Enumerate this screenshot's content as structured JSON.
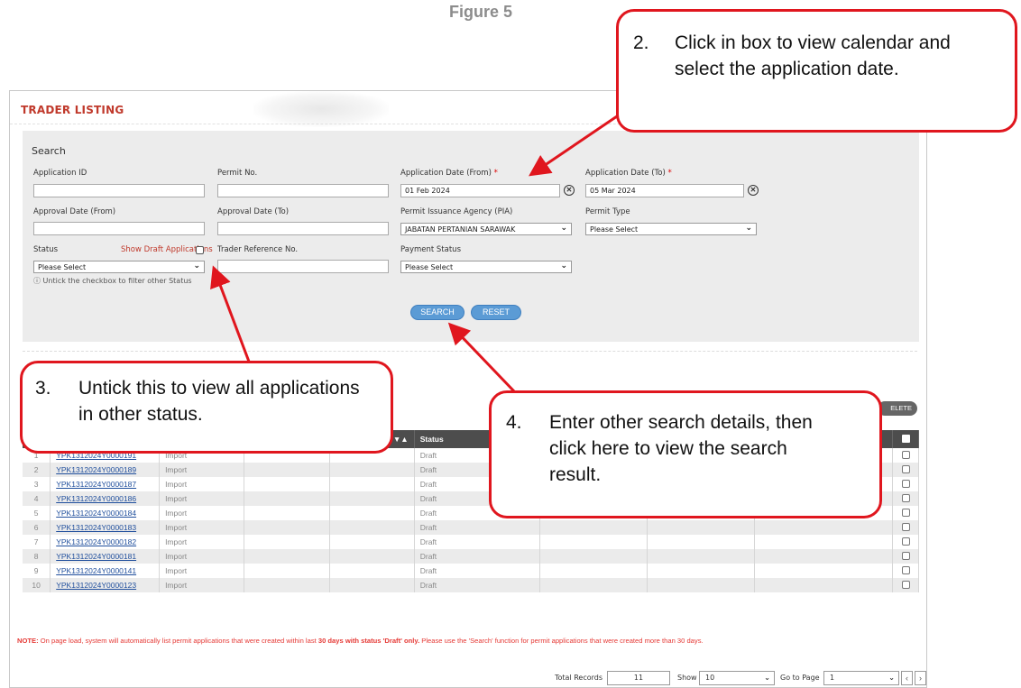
{
  "figure_title": "Figure 5",
  "page_title": "TRADER LISTING",
  "search": {
    "heading": "Search",
    "application_id_label": "Application ID",
    "application_id_value": "",
    "permit_no_label": "Permit No.",
    "permit_no_value": "",
    "app_date_from_label": "Application Date (From)",
    "app_date_from_value": "01 Feb 2024",
    "app_date_to_label": "Application Date (To)",
    "app_date_to_value": "05 Mar 2024",
    "required_mark": "*",
    "approval_date_from_label": "Approval Date (From)",
    "approval_date_to_label": "Approval Date (To)",
    "pia_label": "Permit Issuance Agency (PIA)",
    "pia_value": "JABATAN PERTANIAN SARAWAK",
    "permit_type_label": "Permit Type",
    "permit_type_value": "Please Select",
    "status_label": "Status",
    "show_draft_label": "Show Draft Applications",
    "status_value": "Please Select",
    "trader_ref_label": "Trader Reference No.",
    "payment_status_label": "Payment Status",
    "payment_status_value": "Please Select",
    "hint": "Untick the checkbox to filter other Status",
    "search_button": "SEARCH",
    "reset_button": "RESET"
  },
  "delete_button": "ELETE",
  "table": {
    "status_header": "Status",
    "sort_glyph": "▼▲",
    "rows": [
      {
        "no": "1",
        "id": "YPK1312024Y0000191",
        "type": "Import",
        "status": "Draft"
      },
      {
        "no": "2",
        "id": "YPK1312024Y0000189",
        "type": "Import",
        "status": "Draft"
      },
      {
        "no": "3",
        "id": "YPK1312024Y0000187",
        "type": "Import",
        "status": "Draft"
      },
      {
        "no": "4",
        "id": "YPK1312024Y0000186",
        "type": "Import",
        "status": "Draft"
      },
      {
        "no": "5",
        "id": "YPK1312024Y0000184",
        "type": "Import",
        "status": "Draft"
      },
      {
        "no": "6",
        "id": "YPK1312024Y0000183",
        "type": "Import",
        "status": "Draft"
      },
      {
        "no": "7",
        "id": "YPK1312024Y0000182",
        "type": "Import",
        "status": "Draft"
      },
      {
        "no": "8",
        "id": "YPK1312024Y0000181",
        "type": "Import",
        "status": "Draft"
      },
      {
        "no": "9",
        "id": "YPK1312024Y0000141",
        "type": "Import",
        "status": "Draft"
      },
      {
        "no": "10",
        "id": "YPK1312024Y0000123",
        "type": "Import",
        "status": "Draft"
      }
    ]
  },
  "note": {
    "prefix": "NOTE:",
    "part1": " On page load, system will automatically list permit applications that were created within last ",
    "bold": "30 days with status 'Draft' only.",
    "part2": " Please use the 'Search' function for permit applications that were created more than 30 days."
  },
  "pager": {
    "total_records_label": "Total Records",
    "total_records_value": "11",
    "show_label": "Show",
    "show_value": "10",
    "go_to_page_label": "Go to Page",
    "go_to_page_value": "1"
  },
  "callouts": {
    "c2_num": "2.",
    "c2_text": "Click in box to view calendar and select the application date.",
    "c3_num": "3.",
    "c3_text": "Untick this to view all applications in other status.",
    "c4_num": "4.",
    "c4_text": "Enter other search details, then click here to view the search result."
  },
  "colors": {
    "callout_border": "#e0161e",
    "title_red": "#c0392b",
    "button_blue": "#5b9bd5",
    "header_dark": "#4d4d4d"
  }
}
